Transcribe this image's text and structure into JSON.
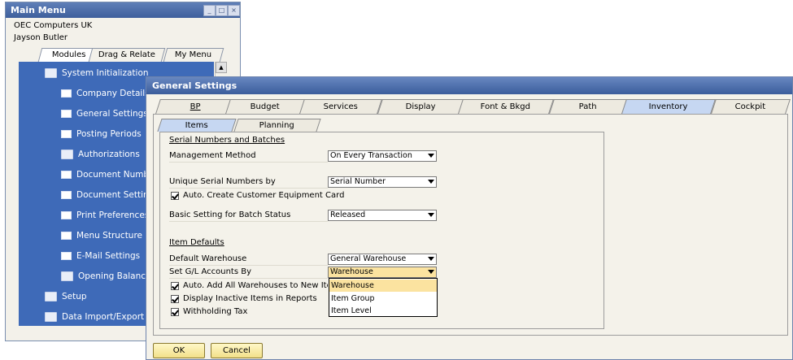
{
  "main_menu": {
    "title": "Main Menu",
    "company": "OEC Computers UK",
    "user": "Jayson Butler",
    "window_buttons": [
      "_",
      "□",
      "×"
    ],
    "tabs": [
      "Modules",
      "Drag & Relate",
      "My Menu"
    ],
    "tree": {
      "root": "System Initialization",
      "children": [
        "Company Details",
        "General Settings",
        "Posting Periods",
        "Authorizations",
        "Document Number",
        "Document Setting",
        "Print Preferences",
        "Menu Structure",
        "E-Mail Settings",
        "Opening Balances"
      ],
      "siblings": [
        "Setup",
        "Data Import/Export"
      ]
    }
  },
  "general_settings": {
    "title": "General Settings",
    "tabs": [
      "BP",
      "Budget",
      "Services",
      "Display",
      "Font & Bkgd",
      "Path",
      "Inventory",
      "Cockpit"
    ],
    "active_tab": "Inventory",
    "subtabs": [
      "Items",
      "Planning"
    ],
    "section_serial": "Serial Numbers and Batches",
    "management_method_label": "Management Method",
    "management_method_value": "On Every Transaction",
    "unique_serial_label": "Unique Serial Numbers by",
    "unique_serial_value": "Serial Number",
    "auto_create_equipment_label": "Auto. Create Customer Equipment Card",
    "batch_status_label": "Basic Setting for Batch Status",
    "batch_status_value": "Released",
    "section_item_defaults": "Item Defaults",
    "default_warehouse_label": "Default Warehouse",
    "default_warehouse_value": "General Warehouse",
    "gl_accounts_label": "Set G/L Accounts By",
    "gl_accounts_value": "Warehouse",
    "gl_options": [
      "Warehouse",
      "Item Group",
      "Item Level"
    ],
    "auto_add_warehouses_label": "Auto. Add All Warehouses to New Items",
    "display_inactive_label": "Display Inactive Items in Reports",
    "withholding_tax_label": "Withholding Tax",
    "ok_label": "OK",
    "cancel_label": "Cancel"
  }
}
